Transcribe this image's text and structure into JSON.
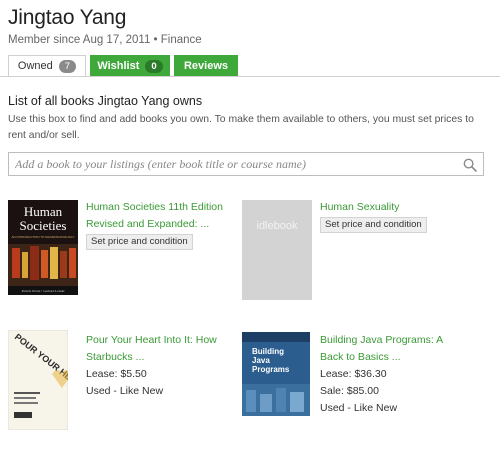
{
  "profile": {
    "name": "Jingtao Yang",
    "member_line": "Member since Aug 17, 2011 • Finance"
  },
  "tabs": [
    {
      "label": "Owned",
      "count": "7",
      "active": true
    },
    {
      "label": "Wishlist",
      "count": "0",
      "active": false
    },
    {
      "label": "Reviews",
      "active": false
    }
  ],
  "list": {
    "heading": "List of all books Jingtao Yang owns",
    "instructions": "Use this box to find and add books you own. To make them available to others, you must set prices to rent and/or sell."
  },
  "search": {
    "placeholder": "Add a book to your listings (enter book title or course name)",
    "icon": "search-icon"
  },
  "books": [
    {
      "title_line1": "Human Societies 11th Edition",
      "title_line2": "Revised and Expanded: ...",
      "action": "Set price and condition",
      "cover": {
        "title_line1": "Human",
        "title_line2": "Societies",
        "subtitle": "AN INTRODUCTION TO MACROSOCIOLOGY",
        "authors": "Patrick Nolan • Gerhard Lenski"
      }
    },
    {
      "title_line1": "Human Sexuality",
      "action": "Set price and condition",
      "cover": {
        "placeholder_text": "idlebook"
      }
    },
    {
      "title_line1": "Pour Your Heart Into It: How",
      "title_line2": "Starbucks ...",
      "lease": "Lease: $5.50",
      "condition": "Used - Like New",
      "cover": {
        "big_text": "POUR YOUR HEART INTO IT"
      }
    },
    {
      "title_line1": "Building Java Programs: A",
      "title_line2": "Back to Basics ...",
      "lease": "Lease: $36.30",
      "sale": "Sale: $85.00",
      "condition": "Used - Like New",
      "cover": {
        "title_line1": "Building",
        "title_line2": "Java",
        "title_line3": "Programs"
      }
    }
  ],
  "colors": {
    "accent_green": "#3fa83b",
    "link_green": "#3a9a36"
  }
}
